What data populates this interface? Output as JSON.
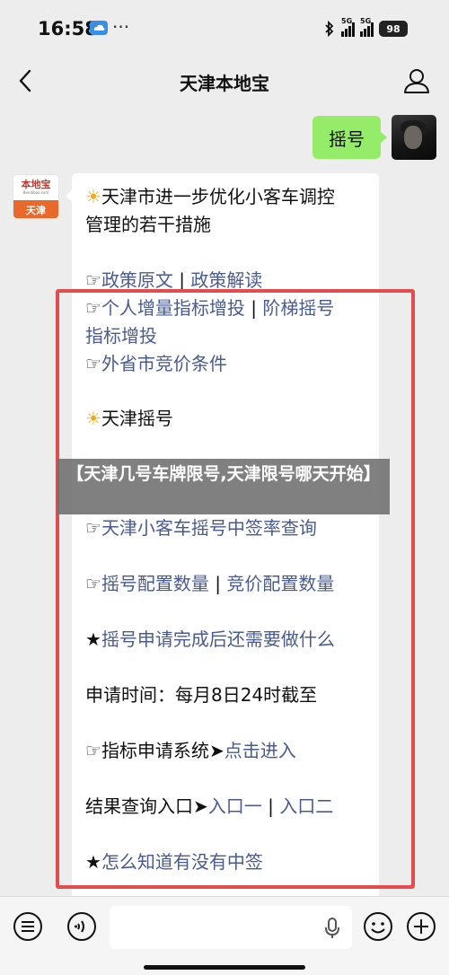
{
  "status_bar": {
    "time": "16:58",
    "dots": "···",
    "signal1": "5G",
    "signal2": "5G",
    "battery": "98"
  },
  "nav": {
    "title": "天津本地宝"
  },
  "chat": {
    "user_message": "摇号",
    "bot_avatar": {
      "top_text": "本地宝",
      "sub_text": "Bendibao.com",
      "bottom_text": "天津"
    },
    "bot_message": {
      "headline_1": "天津市进一步优化小客车调控",
      "headline_2": "管理的若干措施",
      "pointer": "☞",
      "sun": "☀",
      "separator": "|",
      "link_policy_original": "政策原文",
      "link_policy_interpret": "政策解读",
      "link_personal_quota": "个人增量指标增投",
      "link_tiered_1": "阶梯摇号",
      "link_tiered_2": "指标增投",
      "link_out_of_city": "外省市竞价条件",
      "section_title": "天津摇号",
      "link_success_rate": "天津小客车摇号中签率查询",
      "link_lottery_quota": "摇号配置数量",
      "link_bid_quota": "竞价配置数量",
      "star": "★",
      "link_after_apply": "摇号申请完成后还需要做什么",
      "deadline": "申请时间：每月8日24时截至",
      "system_label": "指标申请系统",
      "arrow": "➤",
      "link_enter": "点击进入",
      "result_label": "结果查询入口",
      "link_entry_1": "入口一",
      "link_entry_2": "入口二",
      "link_how_to_know": "怎么知道有没有中签"
    }
  },
  "caption": {
    "text": "【天津几号车牌限号,天津限号哪天开始】"
  },
  "colors": {
    "background": "#ededed",
    "user_bubble": "#95ec69",
    "link": "#4a5b8f",
    "frame": "#e44d4f"
  },
  "icons": [
    "cloud-icon",
    "bluetooth-icon",
    "back-icon",
    "profile-icon",
    "menu-icon",
    "voice-icon",
    "mic-icon",
    "emoji-icon",
    "plus-icon"
  ]
}
